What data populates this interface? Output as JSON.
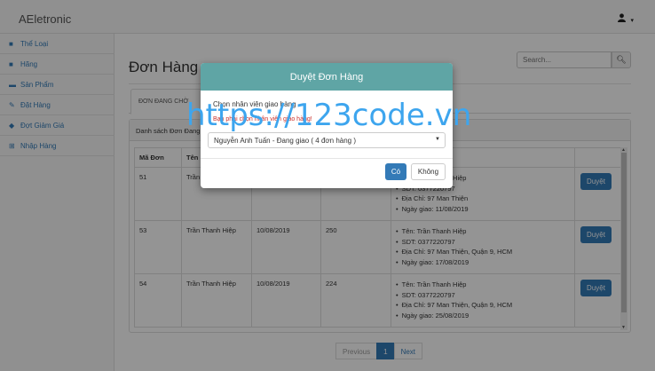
{
  "app": {
    "brand": "AEletronic",
    "user_icon": "user-icon"
  },
  "sidebar": {
    "items": [
      {
        "label": "Thể Loại",
        "icon": "list-icon"
      },
      {
        "label": "Hãng",
        "icon": "folder-icon"
      },
      {
        "label": "Sản Phẩm",
        "icon": "box-icon"
      },
      {
        "label": "Đặt Hàng",
        "icon": "edit-icon"
      },
      {
        "label": "Đợt Giảm Giá",
        "icon": "tag-icon"
      },
      {
        "label": "Nhập Hàng",
        "icon": "import-icon"
      }
    ]
  },
  "main": {
    "title": "Đơn Hàng",
    "search_placeholder": "Search...",
    "tab_active": "ĐƠN ĐANG CHỜ",
    "panel_title": "Danh sách Đơn Đang",
    "columns": [
      "Mã Đơn",
      "Tên"
    ],
    "rows": [
      {
        "id": "51",
        "name": "Trần",
        "date": "",
        "total": "",
        "info": [
          "Tên: Trần Thanh Hiệp",
          "SDT: 0377220797",
          "Địa Chỉ: 97 Man Thiện",
          "Ngày giao: 11/08/2019"
        ],
        "action": "Duyệt"
      },
      {
        "id": "53",
        "name": "Trần Thanh Hiệp",
        "date": "10/08/2019",
        "total": "250",
        "info": [
          "Tên: Trần Thanh Hiệp",
          "SDT: 0377220797",
          "Địa Chỉ: 97 Man Thiện, Quận 9, HCM",
          "Ngày giao: 17/08/2019"
        ],
        "action": "Duyệt"
      },
      {
        "id": "54",
        "name": "Trần Thanh Hiệp",
        "date": "10/08/2019",
        "total": "224",
        "info": [
          "Tên: Trần Thanh Hiệp",
          "SDT: 0377220797",
          "Địa Chỉ: 97 Man Thiện, Quận 9, HCM",
          "Ngày giao: 25/08/2019"
        ],
        "action": "Duyệt"
      }
    ],
    "pagination": {
      "previous": "Previous",
      "current": "1",
      "next": "Next"
    }
  },
  "modal": {
    "title": "Duyệt Đơn Hàng",
    "label": "Chọn nhân viên giao hàng",
    "error": "Bạn phải chọn nhân viên giao hàng!",
    "selected": "Nguyễn Anh Tuấn - Đang giao ( 4 đơn hàng )",
    "confirm": "Có",
    "cancel": "Không"
  },
  "watermark": "https://123code.vn",
  "colors": {
    "primary": "#337ab7",
    "modal_header": "#5fa5a5",
    "watermark": "#3da5ee"
  }
}
